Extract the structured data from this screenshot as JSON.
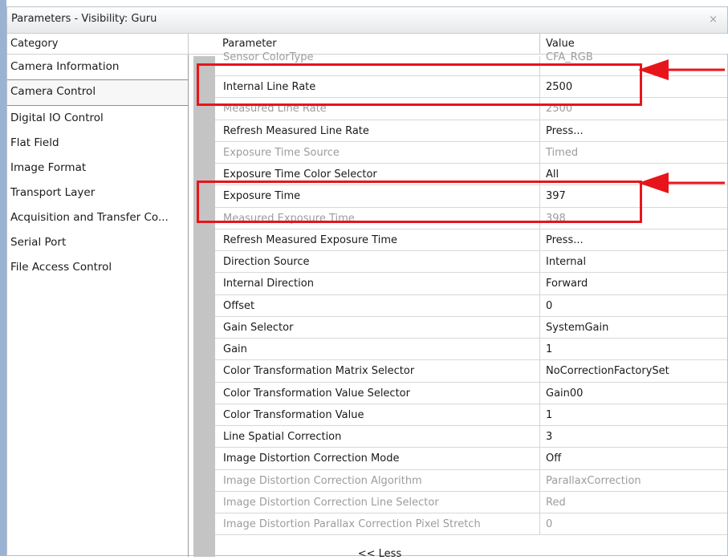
{
  "window": {
    "title": "Parameters - Visibility: Guru",
    "close_glyph": "×"
  },
  "headers": {
    "category": "Category",
    "parameter": "Parameter",
    "value": "Value"
  },
  "categories": [
    "Camera Information",
    "Camera Control",
    "Digital IO Control",
    "Flat Field",
    "Image Format",
    "Transport Layer",
    "Acquisition and Transfer Co...",
    "Serial Port",
    "File Access Control"
  ],
  "selected_category": "Camera Control",
  "parameters": [
    {
      "name": "Sensor ColorType",
      "value": "CFA_RGB",
      "enabled": false
    },
    {
      "name": "Internal Line Rate",
      "value": "2500",
      "enabled": true
    },
    {
      "name": "Measured Line Rate",
      "value": "2500",
      "enabled": false
    },
    {
      "name": "Refresh Measured Line Rate",
      "value": "Press...",
      "enabled": true
    },
    {
      "name": "Exposure Time Source",
      "value": "Timed",
      "enabled": false
    },
    {
      "name": "Exposure Time Color Selector",
      "value": "All",
      "enabled": true
    },
    {
      "name": "Exposure Time",
      "value": "397",
      "enabled": true
    },
    {
      "name": "Measured Exposure Time",
      "value": "398",
      "enabled": false
    },
    {
      "name": "Refresh Measured Exposure Time",
      "value": "Press...",
      "enabled": true
    },
    {
      "name": "Direction Source",
      "value": "Internal",
      "enabled": true
    },
    {
      "name": "Internal Direction",
      "value": "Forward",
      "enabled": true
    },
    {
      "name": "Offset",
      "value": "0",
      "enabled": true
    },
    {
      "name": "Gain Selector",
      "value": "SystemGain",
      "enabled": true
    },
    {
      "name": "Gain",
      "value": "1",
      "enabled": true
    },
    {
      "name": "Color Transformation Matrix Selector",
      "value": "NoCorrectionFactorySet",
      "enabled": true
    },
    {
      "name": "Color Transformation Value Selector",
      "value": "Gain00",
      "enabled": true
    },
    {
      "name": "Color Transformation Value",
      "value": "1",
      "enabled": true
    },
    {
      "name": "Line Spatial Correction",
      "value": "3",
      "enabled": true
    },
    {
      "name": "Image Distortion Correction Mode",
      "value": "Off",
      "enabled": true
    },
    {
      "name": "Image Distortion Correction Algorithm",
      "value": "ParallaxCorrection",
      "enabled": false
    },
    {
      "name": "Image Distortion Correction Line Selector",
      "value": "Red",
      "enabled": false
    },
    {
      "name": "Image Distortion Parallax Correction Pixel Stretch",
      "value": "0",
      "enabled": false
    }
  ],
  "footer": {
    "less_label": "<< Less"
  },
  "annotation_color": "#e8141b"
}
